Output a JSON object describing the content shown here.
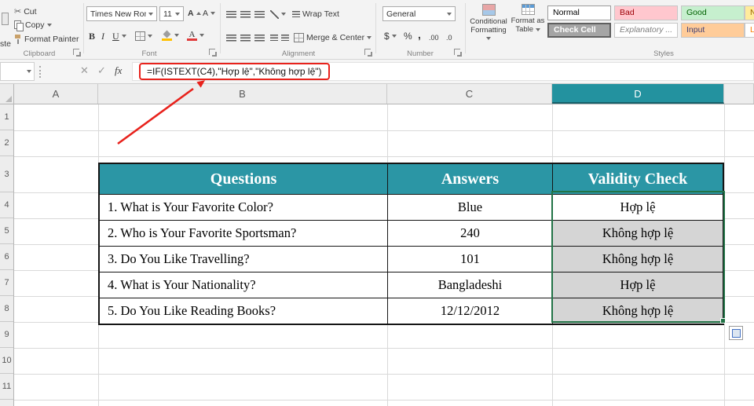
{
  "colors": {
    "table_header_teal": "#2B96A5",
    "selected_column_header": "#23929F",
    "selection_green": "#217346",
    "annotation_red": "#E8221C",
    "selected_cell_gray": "#D5D5D5",
    "style_bad_bg": "#FFC7CE",
    "style_good_bg": "#C6EFCE",
    "style_neutral_bg": "#FFEB9C",
    "style_input_bg": "#FFCC99",
    "style_check_bg": "#A5A5A5"
  },
  "ribbon": {
    "clipboard": {
      "group_label": "Clipboard",
      "paste_partial": "ste",
      "cut": "Cut",
      "copy": "Copy",
      "format_painter": "Format Painter"
    },
    "font": {
      "group_label": "Font",
      "name": "Times New Roma",
      "size": "11",
      "bold": "B",
      "italic": "I",
      "underline": "U"
    },
    "alignment": {
      "group_label": "Alignment",
      "wrap_text": "Wrap Text",
      "merge_center": "Merge & Center"
    },
    "number": {
      "group_label": "Number",
      "format": "General",
      "currency": "$",
      "percent": "%",
      "comma": ",",
      "increase_decimal": ".00",
      "decrease_decimal": ".0"
    },
    "styles": {
      "group_label": "Styles",
      "conditional_formatting": "Conditional Formatting",
      "format_as_table": "Format as Table",
      "cell_styles": [
        {
          "label": "Normal"
        },
        {
          "label": "Bad"
        },
        {
          "label": "Good"
        },
        {
          "label": "Ne"
        },
        {
          "label": "Check Cell"
        },
        {
          "label": "Explanatory ..."
        },
        {
          "label": "Input"
        },
        {
          "label": "Lin"
        }
      ]
    }
  },
  "formula_bar": {
    "name_box_value": "",
    "cancel_glyph": "✕",
    "enter_glyph": "✓",
    "fx_label": "fx",
    "formula": "=IF(ISTEXT(C4),\"Hợp lệ\",\"Không hợp lệ\")"
  },
  "grid": {
    "column_headers": [
      "A",
      "B",
      "C",
      "D"
    ],
    "selected_column": "D",
    "row_numbers": [
      "1",
      "2",
      "3",
      "4",
      "5",
      "6",
      "7",
      "8",
      "9",
      "10",
      "11"
    ]
  },
  "table": {
    "headers": [
      "Questions",
      "Answers",
      "Validity Check"
    ],
    "rows": [
      {
        "question": "1. What is Your Favorite Color?",
        "answer": "Blue",
        "validity": "Hợp lệ"
      },
      {
        "question": "2. Who is Your Favorite Sportsman?",
        "answer": "240",
        "validity": "Không hợp lệ"
      },
      {
        "question": "3. Do You Like Travelling?",
        "answer": "101",
        "validity": "Không hợp lệ"
      },
      {
        "question": "4. What is Your Nationality?",
        "answer": "Bangladeshi",
        "validity": "Hợp lệ"
      },
      {
        "question": "5. Do You Like Reading Books?",
        "answer": "12/12/2012",
        "validity": "Không hợp lệ"
      }
    ]
  }
}
